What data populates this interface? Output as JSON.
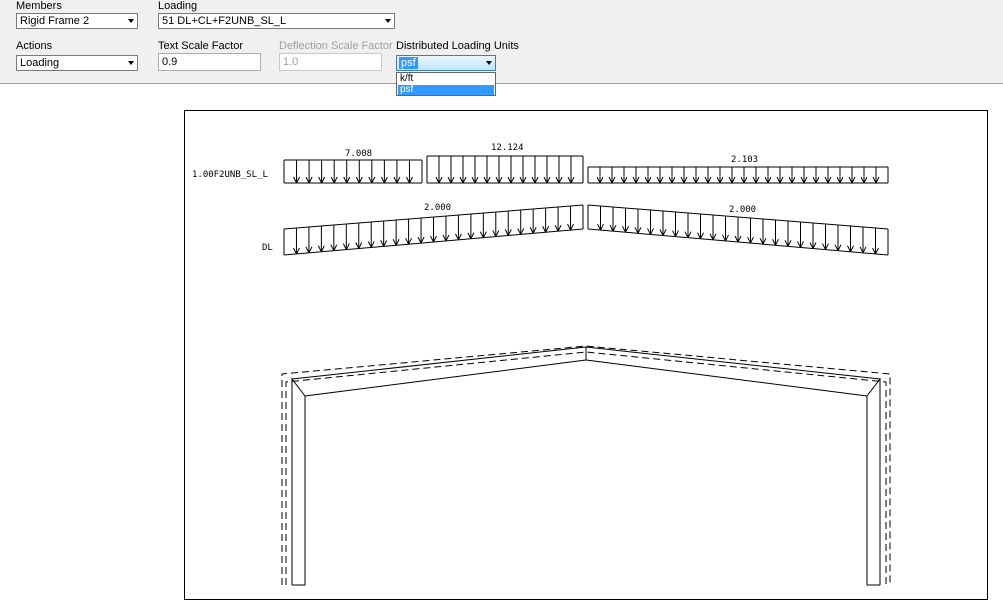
{
  "controls": {
    "members_label": "Members",
    "members_value": "Rigid Frame 2",
    "loading_label": "Loading",
    "loading_value": "51  DL+CL+F2UNB_SL_L",
    "actions_label": "Actions",
    "actions_value": "Loading",
    "text_scale_label": "Text Scale Factor",
    "text_scale_value": "0.9",
    "deflection_scale_label": "Deflection Scale Factor",
    "deflection_scale_value": "1.0",
    "units_label": "Distributed Loading Units",
    "units_value": "psf",
    "units_options": [
      "k/ft",
      "psf"
    ],
    "units_selected_index": 1
  },
  "diagram": {
    "load_cases": [
      {
        "name": "1.00F2UNB_SL_L",
        "segments": [
          "7.008",
          "12.124",
          "2.103"
        ]
      },
      {
        "name": "DL",
        "segments": [
          "2.000",
          "2.000"
        ]
      }
    ]
  }
}
